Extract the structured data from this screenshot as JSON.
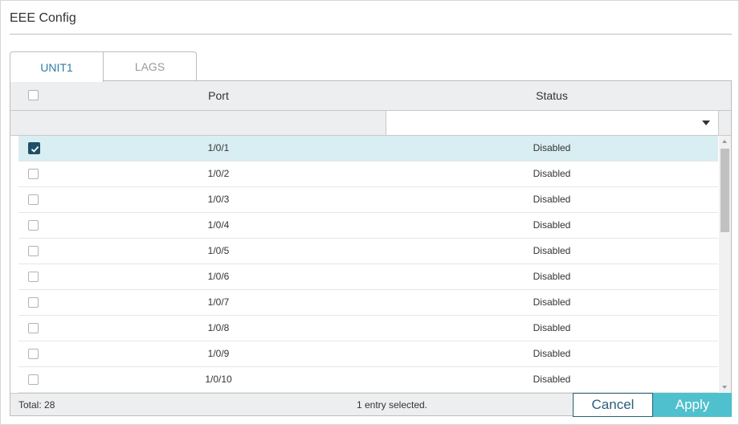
{
  "header": {
    "title": "EEE Config"
  },
  "tabs": [
    {
      "label": "UNIT1",
      "active": true
    },
    {
      "label": "LAGS",
      "active": false
    }
  ],
  "table": {
    "columns": {
      "port": "Port",
      "status": "Status"
    },
    "status_filter": "",
    "rows": [
      {
        "port": "1/0/1",
        "status": "Disabled",
        "checked": true
      },
      {
        "port": "1/0/2",
        "status": "Disabled",
        "checked": false
      },
      {
        "port": "1/0/3",
        "status": "Disabled",
        "checked": false
      },
      {
        "port": "1/0/4",
        "status": "Disabled",
        "checked": false
      },
      {
        "port": "1/0/5",
        "status": "Disabled",
        "checked": false
      },
      {
        "port": "1/0/6",
        "status": "Disabled",
        "checked": false
      },
      {
        "port": "1/0/7",
        "status": "Disabled",
        "checked": false
      },
      {
        "port": "1/0/8",
        "status": "Disabled",
        "checked": false
      },
      {
        "port": "1/0/9",
        "status": "Disabled",
        "checked": false
      },
      {
        "port": "1/0/10",
        "status": "Disabled",
        "checked": false
      }
    ]
  },
  "footer": {
    "total": "Total: 28",
    "selected_info": "1 entry selected.",
    "cancel_label": "Cancel",
    "apply_label": "Apply"
  },
  "colors": {
    "accent": "#4fc0cd",
    "selected_row": "#d9eef2",
    "checkbox_checked": "#1f4f66",
    "tab_active_text": "#2d7ca8"
  }
}
